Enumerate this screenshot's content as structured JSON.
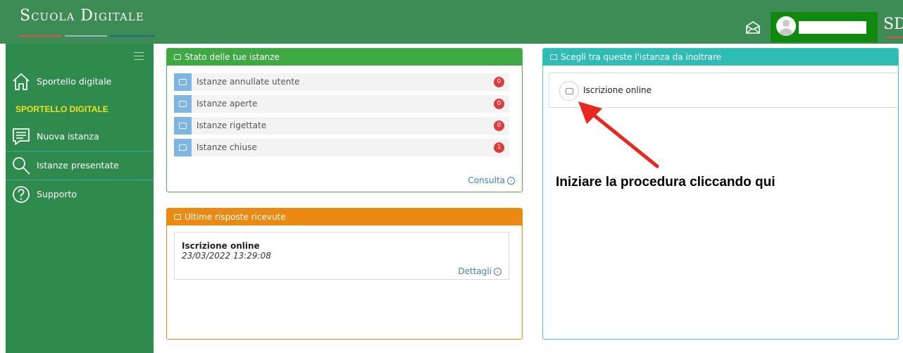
{
  "header": {
    "logo_text": "Scuola Digitale",
    "logo_short": "SD",
    "envelope_icon": "envelope-open-icon",
    "user_icon": "user-avatar-icon"
  },
  "sidebar": {
    "section_title": "SPORTELLO DIGITALE",
    "items": [
      {
        "label": "Sportello digitale",
        "icon": "home-icon"
      },
      {
        "label": "Nuova istanza",
        "icon": "document-list-icon"
      },
      {
        "label": "Istanze presentate",
        "icon": "search-icon"
      },
      {
        "label": "Supporto",
        "icon": "question-circle-icon"
      }
    ]
  },
  "stato": {
    "title": "Stato delle tue istanze",
    "rows": [
      {
        "label": "Istanze annullate utente",
        "count": "0"
      },
      {
        "label": "Istanze aperte",
        "count": "0"
      },
      {
        "label": "Istanze rigettate",
        "count": "0"
      },
      {
        "label": "Istanze chiuse",
        "count": "1"
      }
    ],
    "consulta_label": "Consulta"
  },
  "ultime": {
    "title": "Ultime risposte ricevute",
    "item_title": "Iscrizione online",
    "item_date": "23/03/2022 13:29:08",
    "dettagli_label": "Dettagli"
  },
  "scegli": {
    "title": "Scegli tra queste l'istanza da inoltrare",
    "item_label": "Iscrizione online"
  },
  "annotation": {
    "text": "Iniziare la procedura cliccando qui",
    "color": "#e8281e"
  },
  "colors": {
    "header_green": "#3d8b55",
    "sidebar_green": "#2f8a4e",
    "stato_green": "#3ea843",
    "ultime_orange": "#ea8a12",
    "scegli_teal": "#2fbcb4",
    "badge_red": "#e03b3b",
    "section_yellow": "#f0e21e"
  }
}
